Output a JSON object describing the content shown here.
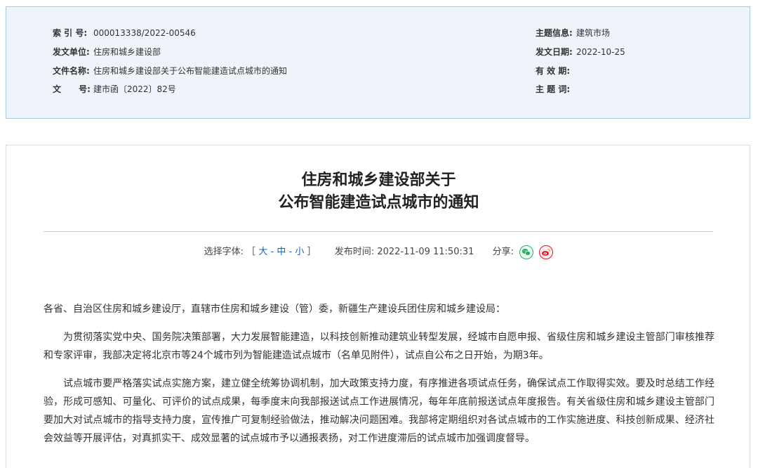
{
  "meta": {
    "index_label": "索 引 号:",
    "index_value": "000013338/2022-00546",
    "issuer_label": "发文单位:",
    "issuer_value": "住房和城乡建设部",
    "title_label": "文件名称:",
    "title_value": "住房和城乡建设部关于公布智能建造试点城市的通知",
    "docno_label": "文      号:",
    "docno_value": "建市函〔2022〕82号",
    "topic_label": "主题信息:",
    "topic_value": "建筑市场",
    "date_label": "发文日期:",
    "date_value": "2022-10-25",
    "validity_label": "有 效 期:",
    "validity_value": "",
    "keywords_label": "主 题 词:",
    "keywords_value": ""
  },
  "article": {
    "title_line1": "住房和城乡建设部关于",
    "title_line2": "公布智能建造试点城市的通知",
    "font_select_label": "选择字体:",
    "bracket_open": "［",
    "bracket_close": "］",
    "font_large": "大",
    "font_medium": "中",
    "font_small": "小",
    "separator": "-",
    "publish_label": "发布时间:",
    "publish_time": "2022-11-09 11:50:31",
    "share_label": "分享:",
    "salutation": "各省、自治区住房和城乡建设厅，直辖市住房和城乡建设（管）委，新疆生产建设兵团住房和城乡建设局：",
    "para1": "为贯彻落实党中央、国务院决策部署，大力发展智能建造，以科技创新推动建筑业转型发展，经城市自愿申报、省级住房和城乡建设主管部门审核推荐和专家评审，我部决定将北京市等24个城市列为智能建造试点城市（名单见附件），试点自公布之日开始，为期3年。",
    "para2": "试点城市要严格落实试点实施方案，建立健全统筹协调机制，加大政策支持力度，有序推进各项试点任务，确保试点工作取得实效。要及时总结工作经验，形成可感知、可量化、可评价的试点成果，每季度末向我部报送试点工作进展情况，每年年底前报送试点年度报告。有关省级住房和城乡建设主管部门要加大对试点城市的指导支持力度，宣传推广可复制经验做法，推动解决问题困难。我部将定期组织对各试点城市的工作实施进度、科技创新成果、经济社会效益等开展评估，对真抓实干、成效显著的试点城市予以通报表扬，对工作进度滞后的试点城市加强调度督导。"
  },
  "icons": {
    "wechat": "wechat-icon",
    "weibo": "weibo-icon"
  },
  "colors": {
    "meta_bg": "#eef4f9",
    "meta_border": "#a9c9dc",
    "link": "#1a63b8",
    "wechat": "#2aae67",
    "weibo": "#e6162d"
  }
}
